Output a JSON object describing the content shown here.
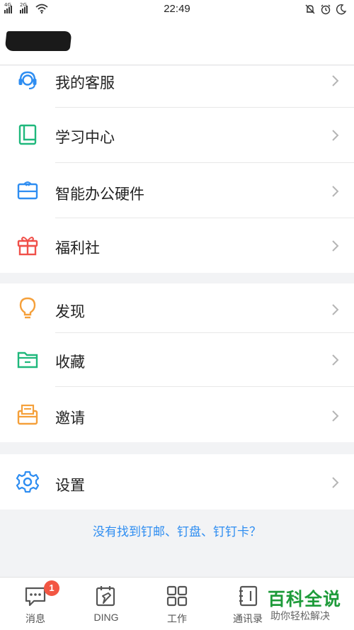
{
  "status_bar": {
    "time": "22:49",
    "network_1": "4G",
    "network_2": "2G"
  },
  "menu_groups": [
    {
      "items": [
        {
          "label": "我的客服",
          "icon": "headset-icon"
        },
        {
          "label": "学习中心",
          "icon": "book-icon"
        },
        {
          "label": "智能办公硬件",
          "icon": "hardware-icon"
        },
        {
          "label": "福利社",
          "icon": "gift-icon"
        }
      ]
    },
    {
      "items": [
        {
          "label": "发现",
          "icon": "lightbulb-icon"
        },
        {
          "label": "收藏",
          "icon": "folder-icon"
        },
        {
          "label": "邀请",
          "icon": "envelope-icon"
        }
      ]
    },
    {
      "items": [
        {
          "label": "设置",
          "icon": "gear-icon"
        }
      ]
    }
  ],
  "footer_link": "没有找到钉邮、钉盘、钉钉卡？",
  "tabbar": {
    "tabs": [
      {
        "label": "消息",
        "icon": "chat-icon",
        "badge": "1"
      },
      {
        "label": "DING",
        "icon": "ding-icon"
      },
      {
        "label": "工作",
        "icon": "grid-icon"
      },
      {
        "label": "通讯录",
        "icon": "contacts-icon"
      }
    ]
  },
  "watermark": {
    "title": "百科全说",
    "subtitle": "助你轻松解决"
  },
  "colors": {
    "blue": "#2e8df1",
    "green": "#1fb87c",
    "red": "#f0504a",
    "orange": "#f5a03a",
    "badge": "#f25643",
    "watermark_green": "#1e9b3a"
  }
}
